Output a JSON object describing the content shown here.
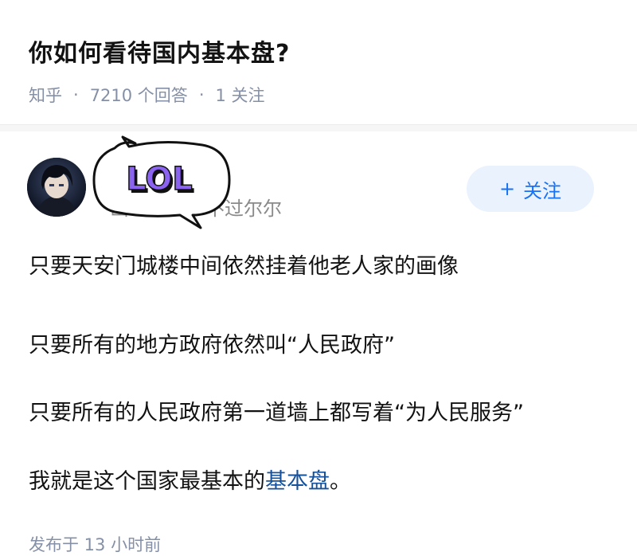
{
  "question": {
    "title": "你如何看待国内基本盘?",
    "source": "知乎",
    "answers_count": "7210 个回答",
    "followers": "1 关注"
  },
  "answer": {
    "author_name": "",
    "author_bio": "山山而川，不过尔尔",
    "sticker_text": "LOL",
    "follow_label": "关注",
    "paragraphs": [
      "只要天安门城楼中间依然挂着他老人家的画像",
      "只要所有的地方政府依然叫“人民政府”",
      "只要所有的人民政府第一道墙上都写着“为人民服务”"
    ],
    "last_prefix": "我就是这个国家最基本的",
    "last_link": "基本盘",
    "last_suffix": "。",
    "posted": "发布于 13 小时前"
  },
  "colors": {
    "accent": "#1772f6",
    "link": "#175199",
    "meta": "#8590a6",
    "sticker": "#8a63f0"
  },
  "icons": {
    "follow": "plus-icon",
    "sticker": "lol-speech-bubble"
  }
}
